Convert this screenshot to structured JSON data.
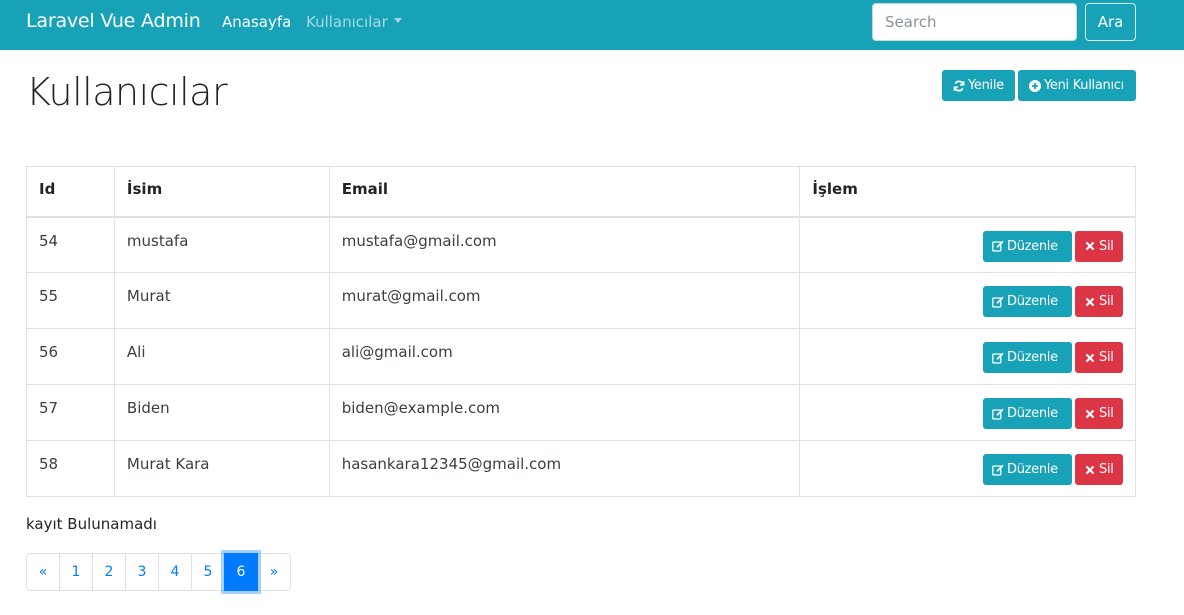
{
  "navbar": {
    "brand": "Laravel Vue Admin",
    "links": {
      "home": "Anasayfa",
      "users": "Kullanıcılar"
    },
    "search": {
      "placeholder": "Search",
      "value": "",
      "button": "Ara"
    }
  },
  "page": {
    "title": "Kullanıcılar",
    "refresh_label": "Yenile",
    "new_user_label": "Yeni Kullanıcı"
  },
  "table": {
    "headers": {
      "id": "Id",
      "name": "İsim",
      "email": "Email",
      "action": "İşlem"
    },
    "rows": [
      {
        "id": "54",
        "name": "mustafa",
        "email": "mustafa@gmail.com"
      },
      {
        "id": "55",
        "name": "Murat",
        "email": "murat@gmail.com"
      },
      {
        "id": "56",
        "name": "Ali",
        "email": "ali@gmail.com"
      },
      {
        "id": "57",
        "name": "Biden",
        "email": "biden@example.com"
      },
      {
        "id": "58",
        "name": "Murat Kara",
        "email": "hasankara12345@gmail.com"
      }
    ],
    "edit_label": "Düzenle",
    "delete_label": "Sil"
  },
  "empty_message": "kayıt Bulunamadı",
  "pagination": {
    "prev": "«",
    "next": "»",
    "pages": [
      "1",
      "2",
      "3",
      "4",
      "5",
      "6"
    ],
    "active": "6"
  },
  "icons": {
    "refresh": "refresh-icon",
    "new_user": "plus-circle-icon",
    "edit": "edit-icon",
    "delete": "close-icon",
    "dropdown": "caret-down-icon"
  },
  "colors": {
    "primary": "#17a2b8",
    "danger": "#dc3545",
    "link": "#007bff"
  }
}
